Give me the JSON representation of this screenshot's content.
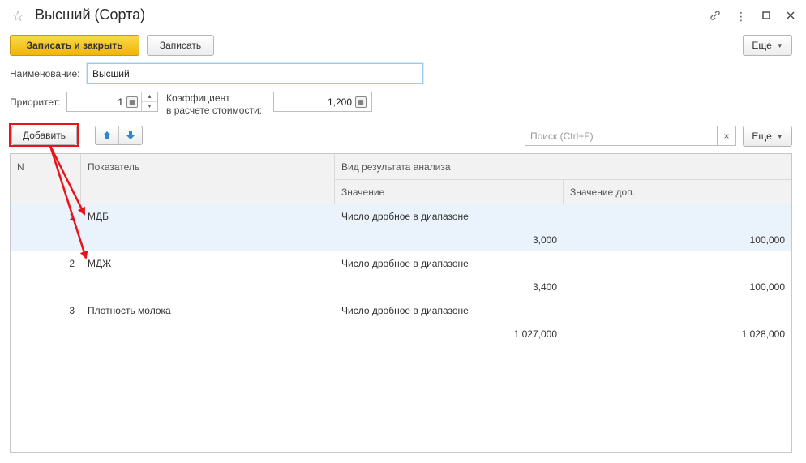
{
  "window": {
    "title": "Высший (Сорта)",
    "icons": [
      "star-icon",
      "link-icon",
      "more-vertical-icon",
      "maximize-icon",
      "close-icon"
    ]
  },
  "toolbar": {
    "save_close_label": "Записать и закрыть",
    "save_label": "Записать",
    "more_label": "Еще"
  },
  "form": {
    "name_label": "Наименование:",
    "name_value": "Высший",
    "priority_label": "Приоритет:",
    "priority_value": "1",
    "coef_label_line1": "Коэффициент",
    "coef_label_line2": "в расчете стоимости:",
    "coef_value": "1,200"
  },
  "table_toolbar": {
    "add_label": "Добавить",
    "search_placeholder": "Поиск (Ctrl+F)",
    "clear_label": "×",
    "more_label": "Еще"
  },
  "table": {
    "columns": {
      "n": "N",
      "indicator": "Показатель",
      "result_type": "Вид результата анализа",
      "value": "Значение",
      "value_extra": "Значение доп."
    },
    "rows": [
      {
        "n": "1",
        "indicator": "МДБ",
        "result_type": "Число дробное в диапазоне",
        "value": "3,000",
        "value_extra": "100,000"
      },
      {
        "n": "2",
        "indicator": "МДЖ",
        "result_type": "Число дробное в диапазоне",
        "value": "3,400",
        "value_extra": "100,000"
      },
      {
        "n": "3",
        "indicator": "Плотность молока",
        "result_type": "Число дробное в диапазоне",
        "value": "1 027,000",
        "value_extra": "1 028,000"
      }
    ]
  },
  "colors": {
    "accent": "#f5c32c",
    "annotation": "#e8141c",
    "selected_row": "#eaf3fb"
  }
}
